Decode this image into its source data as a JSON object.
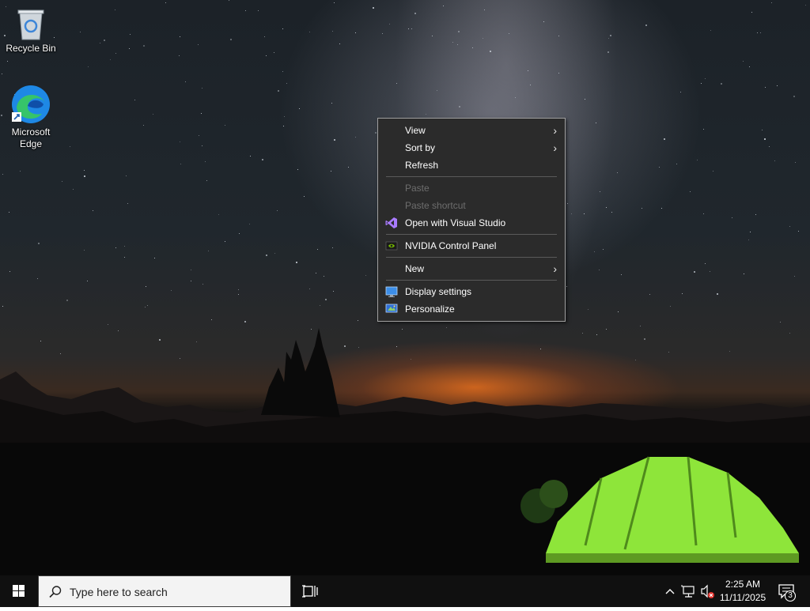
{
  "desktop": {
    "icons": [
      {
        "label": "Recycle Bin",
        "icon": "recycle-bin-icon"
      },
      {
        "label": "Microsoft\nEdge",
        "icon": "edge-icon"
      }
    ]
  },
  "context_menu": {
    "items": [
      {
        "label": "View",
        "submenu": true,
        "enabled": true
      },
      {
        "label": "Sort by",
        "submenu": true,
        "enabled": true
      },
      {
        "label": "Refresh",
        "enabled": true
      },
      {
        "label": "Paste",
        "enabled": false
      },
      {
        "label": "Paste shortcut",
        "enabled": false
      },
      {
        "label": "Open with Visual Studio",
        "icon": "visual-studio-icon",
        "enabled": true
      },
      {
        "label": "NVIDIA Control Panel",
        "icon": "nvidia-icon",
        "enabled": true
      },
      {
        "label": "New",
        "submenu": true,
        "enabled": true
      },
      {
        "label": "Display settings",
        "icon": "display-settings-icon",
        "enabled": true
      },
      {
        "label": "Personalize",
        "icon": "personalize-icon",
        "enabled": true
      }
    ]
  },
  "taskbar": {
    "search_placeholder": "Type here to search",
    "clock": {
      "time": "2:25 AM",
      "date": "11/11/2025"
    },
    "notification_count": "3"
  },
  "colors": {
    "menu_bg": "#2b2b2b",
    "menu_text": "#ffffff",
    "menu_disabled": "#6d6d6d",
    "taskbar_bg": "#101010",
    "tent": "#8ee53a"
  }
}
